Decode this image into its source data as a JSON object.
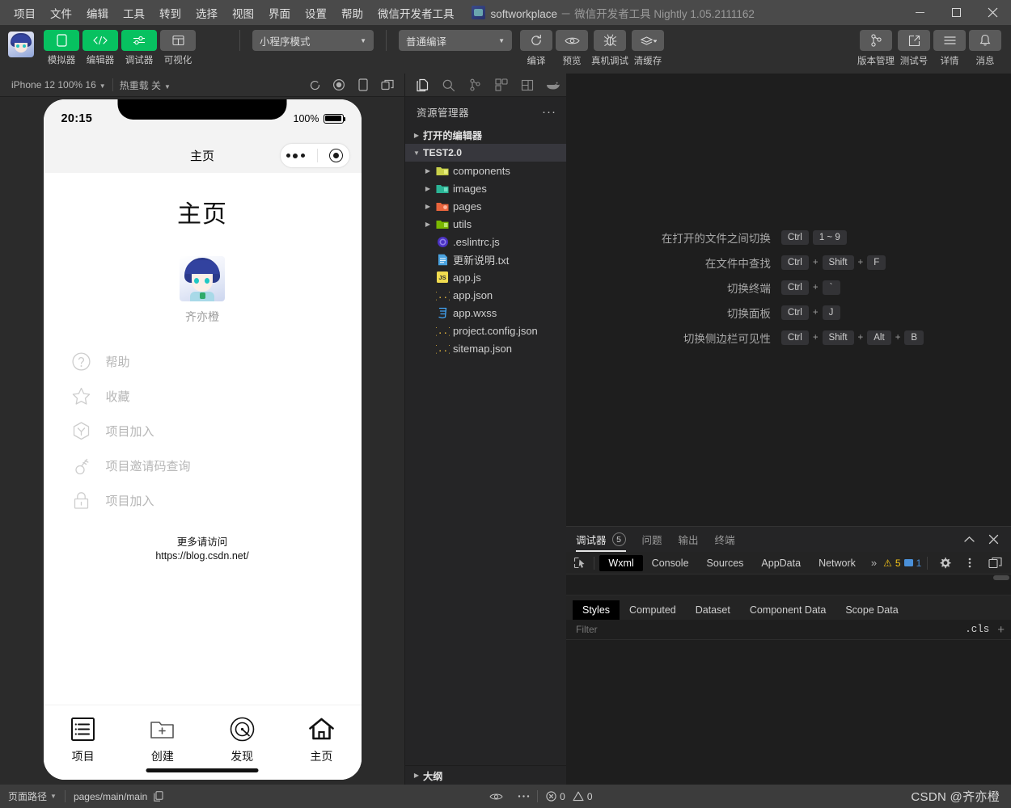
{
  "titlebar": {
    "menus": [
      "项目",
      "文件",
      "编辑",
      "工具",
      "转到",
      "选择",
      "视图",
      "界面",
      "设置",
      "帮助",
      "微信开发者工具"
    ],
    "app_name": "softworkplace",
    "separator": "－",
    "product": "微信开发者工具",
    "version": "Nightly 1.05.2111162"
  },
  "toolbar": {
    "left_items": [
      {
        "label": "模拟器",
        "icon": "phone-icon",
        "style": "green"
      },
      {
        "label": "编辑器",
        "icon": "code-icon",
        "style": "green"
      },
      {
        "label": "调试器",
        "icon": "debug-slider-icon",
        "style": "green"
      },
      {
        "label": "可视化",
        "icon": "layout-icon",
        "style": "grey"
      }
    ],
    "mode_select": "小程序模式",
    "compile_select": "普通编译",
    "action_items": [
      {
        "label": "编译",
        "icon": "refresh-icon"
      },
      {
        "label": "预览",
        "icon": "eye-icon"
      },
      {
        "label": "真机调试",
        "icon": "bug-icon"
      },
      {
        "label": "清缓存",
        "icon": "layers-icon"
      }
    ],
    "right_items": [
      {
        "label": "版本管理",
        "icon": "branch-icon"
      },
      {
        "label": "测试号",
        "icon": "external-link-icon"
      },
      {
        "label": "详情",
        "icon": "hamburger-icon"
      },
      {
        "label": "消息",
        "icon": "bell-icon"
      }
    ]
  },
  "simulator_bar": {
    "device": "iPhone 12 100% 16",
    "hot_reload": "热重载 关",
    "icons": [
      "refresh-icon",
      "record-icon",
      "rotate-device-icon",
      "separate-window-icon"
    ]
  },
  "phone": {
    "status": {
      "time": "20:15",
      "battery_pct": "100%"
    },
    "nav_title": "主页",
    "page_heading": "主页",
    "user_name": "齐亦橙",
    "menu_rows": [
      {
        "label": "帮助",
        "icon": "question-circle-icon"
      },
      {
        "label": "收藏",
        "icon": "star-icon"
      },
      {
        "label": "项目加入",
        "icon": "hexagon-y-icon"
      },
      {
        "label": "项目邀请码查询",
        "icon": "key-icon"
      },
      {
        "label": "项目加入",
        "icon": "lock-icon"
      }
    ],
    "more_line1": "更多请访问",
    "more_line2": "https://blog.csdn.net/",
    "tabbar": [
      {
        "label": "项目",
        "icon": "list-icon"
      },
      {
        "label": "创建",
        "icon": "folder-plus-icon"
      },
      {
        "label": "发现",
        "icon": "compass-icon"
      },
      {
        "label": "主页",
        "icon": "home-icon"
      }
    ]
  },
  "explorer": {
    "activity_icons": [
      "files-icon",
      "search-icon",
      "source-control-icon",
      "extensions-icon",
      "layout-panel-icon",
      "whale-icon"
    ],
    "title": "资源管理器",
    "more_label": "···",
    "tree": [
      {
        "label": "打开的编辑器",
        "type": "section",
        "expanded": false,
        "depth": 0
      },
      {
        "label": "TEST2.0",
        "type": "section",
        "expanded": true,
        "depth": 0,
        "selected": true
      },
      {
        "label": "components",
        "type": "folder",
        "expanded": false,
        "depth": 1,
        "color": "#c9d14a"
      },
      {
        "label": "images",
        "type": "folder",
        "expanded": false,
        "depth": 1,
        "color": "#2bb596"
      },
      {
        "label": "pages",
        "type": "folder",
        "expanded": false,
        "depth": 1,
        "color": "#e8643c"
      },
      {
        "label": "utils",
        "type": "folder",
        "expanded": false,
        "depth": 1,
        "color": "#7ab800"
      },
      {
        "label": ".eslintrc.js",
        "type": "file",
        "depth": 1,
        "icon": "eslint-icon"
      },
      {
        "label": "更新说明.txt",
        "type": "file",
        "depth": 1,
        "icon": "txt-icon"
      },
      {
        "label": "app.js",
        "type": "file",
        "depth": 1,
        "icon": "js-icon"
      },
      {
        "label": "app.json",
        "type": "file",
        "depth": 1,
        "icon": "json-icon"
      },
      {
        "label": "app.wxss",
        "type": "file",
        "depth": 1,
        "icon": "css-icon"
      },
      {
        "label": "project.config.json",
        "type": "file",
        "depth": 1,
        "icon": "json-icon"
      },
      {
        "label": "sitemap.json",
        "type": "file",
        "depth": 1,
        "icon": "json-icon"
      }
    ],
    "outline_label": "大纲",
    "problems": {
      "errors": "0",
      "warnings": "0"
    }
  },
  "editor_welcome": {
    "shortcuts": [
      {
        "label": "在打开的文件之间切换",
        "keys": [
          "Ctrl",
          "1 ~ 9"
        ],
        "joiners": [
          ""
        ]
      },
      {
        "label": "在文件中查找",
        "keys": [
          "Ctrl",
          "Shift",
          "F"
        ],
        "joiners": [
          "+",
          "+"
        ]
      },
      {
        "label": "切换终端",
        "keys": [
          "Ctrl",
          "`"
        ],
        "joiners": [
          "+"
        ]
      },
      {
        "label": "切换面板",
        "keys": [
          "Ctrl",
          "J"
        ],
        "joiners": [
          "+"
        ]
      },
      {
        "label": "切换侧边栏可见性",
        "keys": [
          "Ctrl",
          "Shift",
          "Alt",
          "B"
        ],
        "joiners": [
          "+",
          "+",
          "+"
        ]
      }
    ]
  },
  "debugger": {
    "panel_tabs": [
      {
        "label": "调试器",
        "count": "5",
        "active": true
      },
      {
        "label": "问题",
        "active": false
      },
      {
        "label": "输出",
        "active": false
      },
      {
        "label": "终端",
        "active": false
      }
    ],
    "devtools_tabs": [
      "Wxml",
      "Console",
      "Sources",
      "AppData",
      "Network"
    ],
    "devtools_active": "Wxml",
    "overflow": "»",
    "warning_count": "5",
    "message_count": "1",
    "styles_tabs": [
      "Styles",
      "Computed",
      "Dataset",
      "Component Data",
      "Scope Data"
    ],
    "styles_active": "Styles",
    "filter_placeholder": "Filter",
    "cls_label": ".cls"
  },
  "statusbar": {
    "page_path_label": "页面路径",
    "page_path_value": "pages/main/main",
    "copy_icon": "copy-icon",
    "eye_icon": "eye-icon",
    "more_icon": "more-icon",
    "errors": "0",
    "warnings": "0",
    "watermark": "CSDN @齐亦橙"
  },
  "colors": {
    "wechat_green": "#07c160",
    "titlebar_bg": "#4a4a4a",
    "toolbar_bg": "#2f2f2f",
    "explorer_bg": "#252526",
    "editor_bg": "#1e1e1e",
    "statusbar_bg": "#3c3c3c",
    "warning_yellow": "#f5c518",
    "message_blue": "#4a90d9"
  }
}
